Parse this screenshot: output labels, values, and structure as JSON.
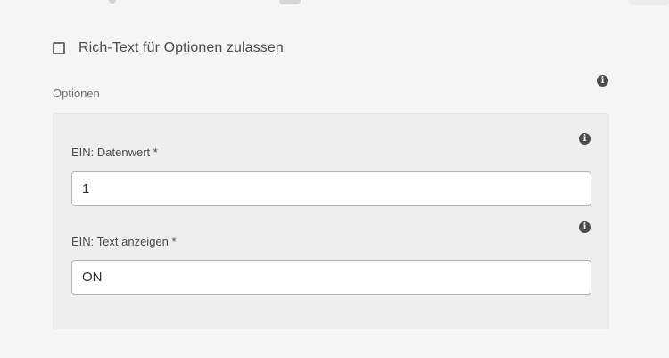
{
  "rich_text_option": {
    "label": "Rich-Text für Optionen zulassen",
    "checked": false
  },
  "options_section": {
    "label": "Optionen",
    "info_icon": "info-icon"
  },
  "fields": [
    {
      "label": "EIN: Datenwert *",
      "value": "1",
      "info_icon": "info-icon"
    },
    {
      "label": "EIN: Text anzeigen *",
      "value": "ON",
      "info_icon": "info-icon"
    }
  ],
  "colors": {
    "background": "#f5f5f5",
    "panel": "#eeeeee",
    "text": "#4b4b4b",
    "input_border": "#b3b3b3"
  }
}
